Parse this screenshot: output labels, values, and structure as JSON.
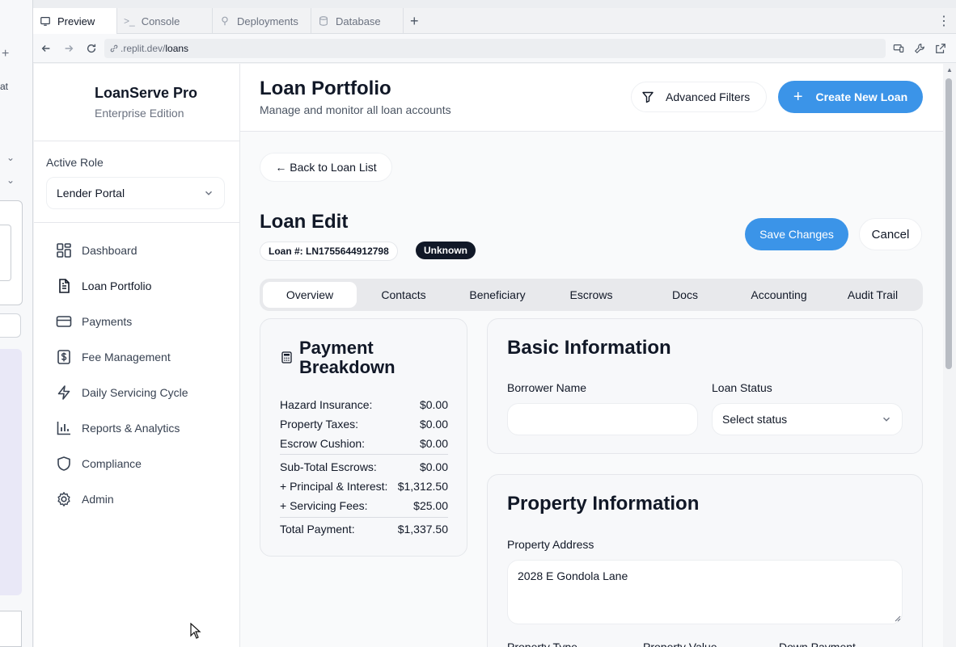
{
  "browser": {
    "tabs": [
      {
        "label": "Preview",
        "icon": "preview-icon"
      },
      {
        "label": "Console",
        "icon": "terminal-icon"
      },
      {
        "label": "Deployments",
        "icon": "deploy-icon"
      },
      {
        "label": "Database",
        "icon": "database-icon"
      }
    ],
    "url_host": ".replit.dev/",
    "url_path": "loans"
  },
  "sidebar": {
    "brand_title": "LoanServe Pro",
    "brand_subtitle": "Enterprise Edition",
    "role_label": "Active Role",
    "role_value": "Lender Portal",
    "items": [
      {
        "label": "Dashboard",
        "icon": "grid-icon"
      },
      {
        "label": "Loan Portfolio",
        "icon": "document-icon"
      },
      {
        "label": "Payments",
        "icon": "credit-card-icon"
      },
      {
        "label": "Fee Management",
        "icon": "dollar-icon"
      },
      {
        "label": "Daily Servicing Cycle",
        "icon": "lightning-icon"
      },
      {
        "label": "Reports & Analytics",
        "icon": "bar-chart-icon"
      },
      {
        "label": "Compliance",
        "icon": "shield-icon"
      },
      {
        "label": "Admin",
        "icon": "gear-icon"
      }
    ]
  },
  "header": {
    "title": "Loan Portfolio",
    "subtitle": "Manage and monitor all loan accounts",
    "filters_label": "Advanced Filters",
    "create_label": "Create New Loan"
  },
  "edit": {
    "back_label": "← Back to Loan List",
    "title": "Loan Edit",
    "loan_number": "Loan #: LN1755644912798",
    "status_badge": "Unknown",
    "save_label": "Save Changes",
    "cancel_label": "Cancel",
    "tabs": [
      "Overview",
      "Contacts",
      "Beneficiary",
      "Escrows",
      "Docs",
      "Accounting",
      "Audit Trail"
    ],
    "active_tab": "Overview"
  },
  "breakdown": {
    "title_line1": "Payment",
    "title_line2": "Breakdown",
    "rows": [
      {
        "label": "Hazard Insurance:",
        "value": "$0.00"
      },
      {
        "label": "Property Taxes:",
        "value": "$0.00"
      },
      {
        "label": "Escrow Cushion:",
        "value": "$0.00"
      },
      {
        "label": "Sub-Total Escrows:",
        "value": "$0.00"
      },
      {
        "label": "+ Principal & Interest:",
        "value": "$1,312.50"
      },
      {
        "label": "+ Servicing Fees:",
        "value": "$25.00"
      },
      {
        "label": "Total Payment:",
        "value": "$1,337.50"
      }
    ]
  },
  "basic": {
    "title": "Basic Information",
    "borrower_label": "Borrower Name",
    "borrower_value": "",
    "status_label": "Loan Status",
    "status_placeholder": "Select status"
  },
  "property": {
    "title": "Property Information",
    "address_label": "Property Address",
    "address_value": "2028 E Gondola Lane",
    "type_label": "Property Type",
    "value_label": "Property Value",
    "down_label": "Down Payment"
  },
  "colors": {
    "primary": "#3b94e8",
    "badge_dark": "#111827"
  }
}
